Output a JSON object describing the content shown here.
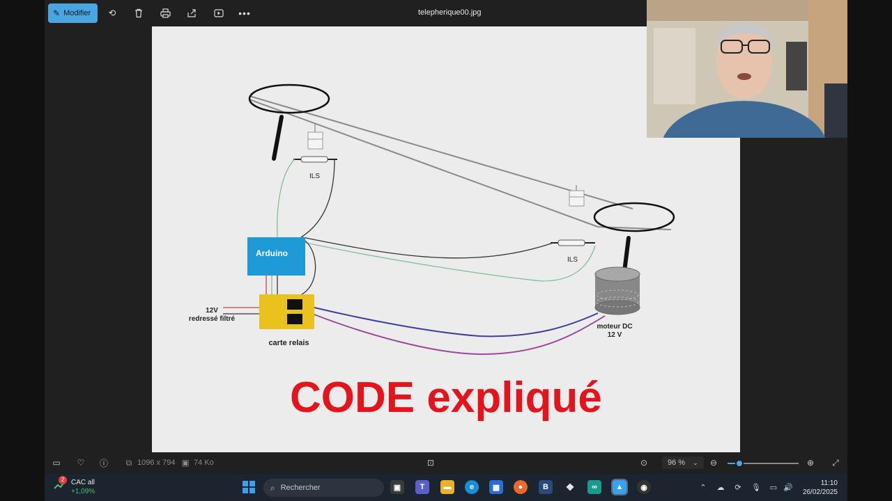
{
  "toolbar": {
    "edit_label": "Modifier",
    "file_title": "telepherique00.jpg",
    "icons": [
      "pencil-icon",
      "rotate-icon",
      "trash-icon",
      "print-icon",
      "share-icon",
      "slideshow-icon",
      "more-icon"
    ]
  },
  "diagram": {
    "ils_top": "ILS",
    "ils_bottom": "ILS",
    "arduino": "Arduino",
    "power_line1": "12V",
    "power_line2": "redressé filtré",
    "relay_label": "carte relais",
    "motor_line1": "moteur DC",
    "motor_line2": "12 V",
    "overlay_title": "CODE expliqué",
    "colors": {
      "title_red": "#e4141c",
      "arduino_blue": "#1e9ad6",
      "relay_yellow": "#e9c21e",
      "wire_blue": "#3b3fa0",
      "wire_purple": "#9a4a9a",
      "wire_green": "#7fc09b"
    }
  },
  "statusbar": {
    "dimensions": "1096 x 794",
    "file_size": "74 Ko",
    "zoom": "96 %",
    "zoom_fraction": 0.17
  },
  "taskbar": {
    "stock_badge": "2",
    "stock_name": "CAC all",
    "stock_change": "+1,09%",
    "search_placeholder": "Rechercher",
    "time": "11:10",
    "date": "26/02/2025"
  }
}
